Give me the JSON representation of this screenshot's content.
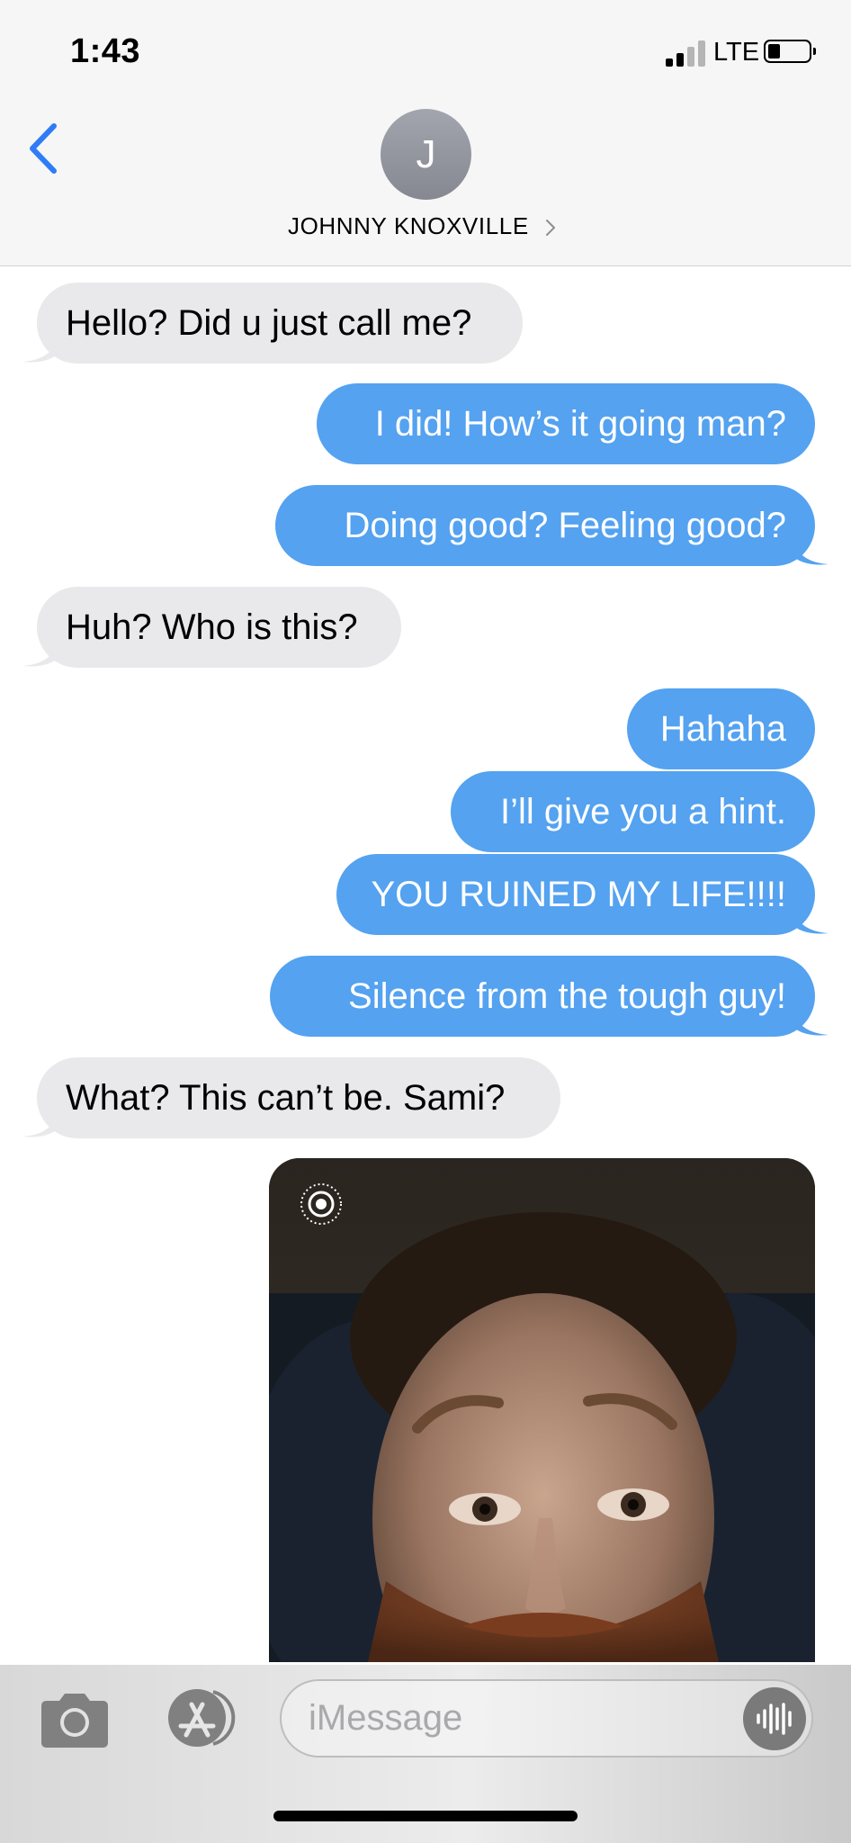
{
  "status": {
    "time": "1:43",
    "carrier": "LTE",
    "signal_bars": 2,
    "signal_total": 4,
    "battery_level": 0.3
  },
  "contact": {
    "initial": "J",
    "name": "JOHNNY KNOXVILLE"
  },
  "messages": [
    {
      "direction": "received",
      "text": "Hello? Did u just call me?"
    },
    {
      "direction": "sent",
      "text": "I did! How’s it going man?"
    },
    {
      "direction": "sent",
      "text": "Doing good? Feeling good?"
    },
    {
      "direction": "received",
      "text": "Huh? Who is this?"
    },
    {
      "direction": "sent",
      "text": "Hahaha"
    },
    {
      "direction": "sent",
      "text": "I’ll give you a hint."
    },
    {
      "direction": "sent",
      "text": "YOU RUINED MY LIFE!!!!"
    },
    {
      "direction": "sent",
      "text": "Silence from the tough guy!"
    },
    {
      "direction": "received",
      "text": "What? This can’t be. Sami?"
    },
    {
      "direction": "sent",
      "type": "live-photo",
      "icon": "live-photo-icon"
    }
  ],
  "input": {
    "placeholder": "iMessage"
  },
  "icons": {
    "back": "chevron-left-icon",
    "camera": "camera-icon",
    "apps": "app-store-icon",
    "audio": "audio-waveform-icon"
  },
  "colors": {
    "sent_bubble": "#54a2f0",
    "received_bubble": "#e9e9eb",
    "accent": "#2f7cf6"
  }
}
